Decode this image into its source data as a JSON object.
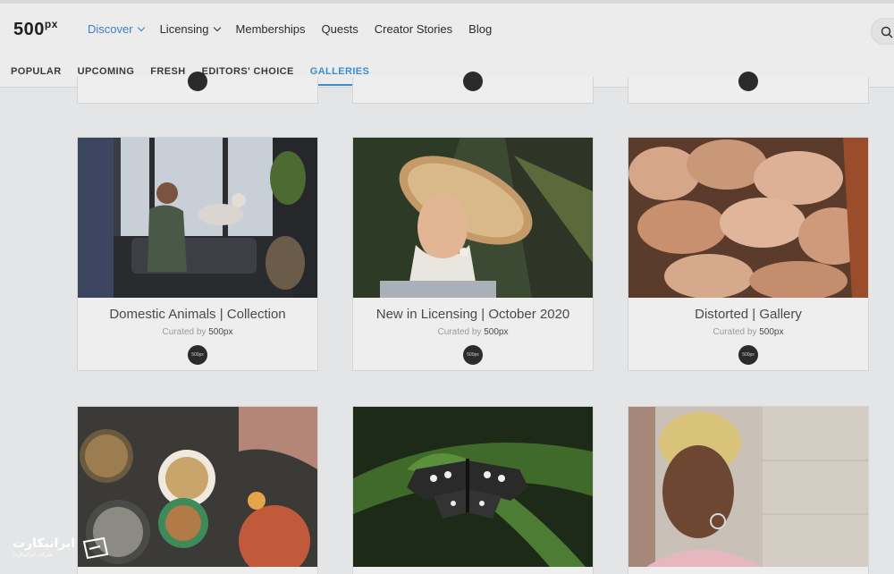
{
  "brand": {
    "logo_main": "500",
    "logo_suffix": "px"
  },
  "nav": {
    "items": [
      {
        "label": "Discover",
        "dropdown": true,
        "active": true
      },
      {
        "label": "Licensing",
        "dropdown": true,
        "active": false
      },
      {
        "label": "Memberships",
        "dropdown": false,
        "active": false
      },
      {
        "label": "Quests",
        "dropdown": false,
        "active": false
      },
      {
        "label": "Creator Stories",
        "dropdown": false,
        "active": false
      },
      {
        "label": "Blog",
        "dropdown": false,
        "active": false
      }
    ],
    "search_icon": "search-icon"
  },
  "tabs": [
    {
      "label": "POPULAR",
      "active": false
    },
    {
      "label": "UPCOMING",
      "active": false
    },
    {
      "label": "FRESH",
      "active": false
    },
    {
      "label": "EDITORS' CHOICE",
      "active": false
    },
    {
      "label": "GALLERIES",
      "active": true
    }
  ],
  "galleries": {
    "curated_prefix": "Curated by",
    "curator": "500px",
    "avatar_text": "500px",
    "cards": [
      {
        "title": "Domestic Animals | Collection",
        "photo": "woman-with-dogs-by-window"
      },
      {
        "title": "New in Licensing | October 2020",
        "photo": "woman-in-straw-hat"
      },
      {
        "title": "Distorted | Gallery",
        "photo": "distorted-faces"
      },
      {
        "title": "",
        "photo": "street-food-bowls"
      },
      {
        "title": "",
        "photo": "butterfly-on-fern"
      },
      {
        "title": "",
        "photo": "woman-portrait-blonde-hair"
      }
    ]
  },
  "watermark": {
    "text": "ایرانیکارت",
    "sub": "شرکت ایرانیکارت"
  },
  "colors": {
    "accent": "#3b8fd0",
    "nav_active": "#3b7fc4",
    "background": "#e4e5e6"
  }
}
